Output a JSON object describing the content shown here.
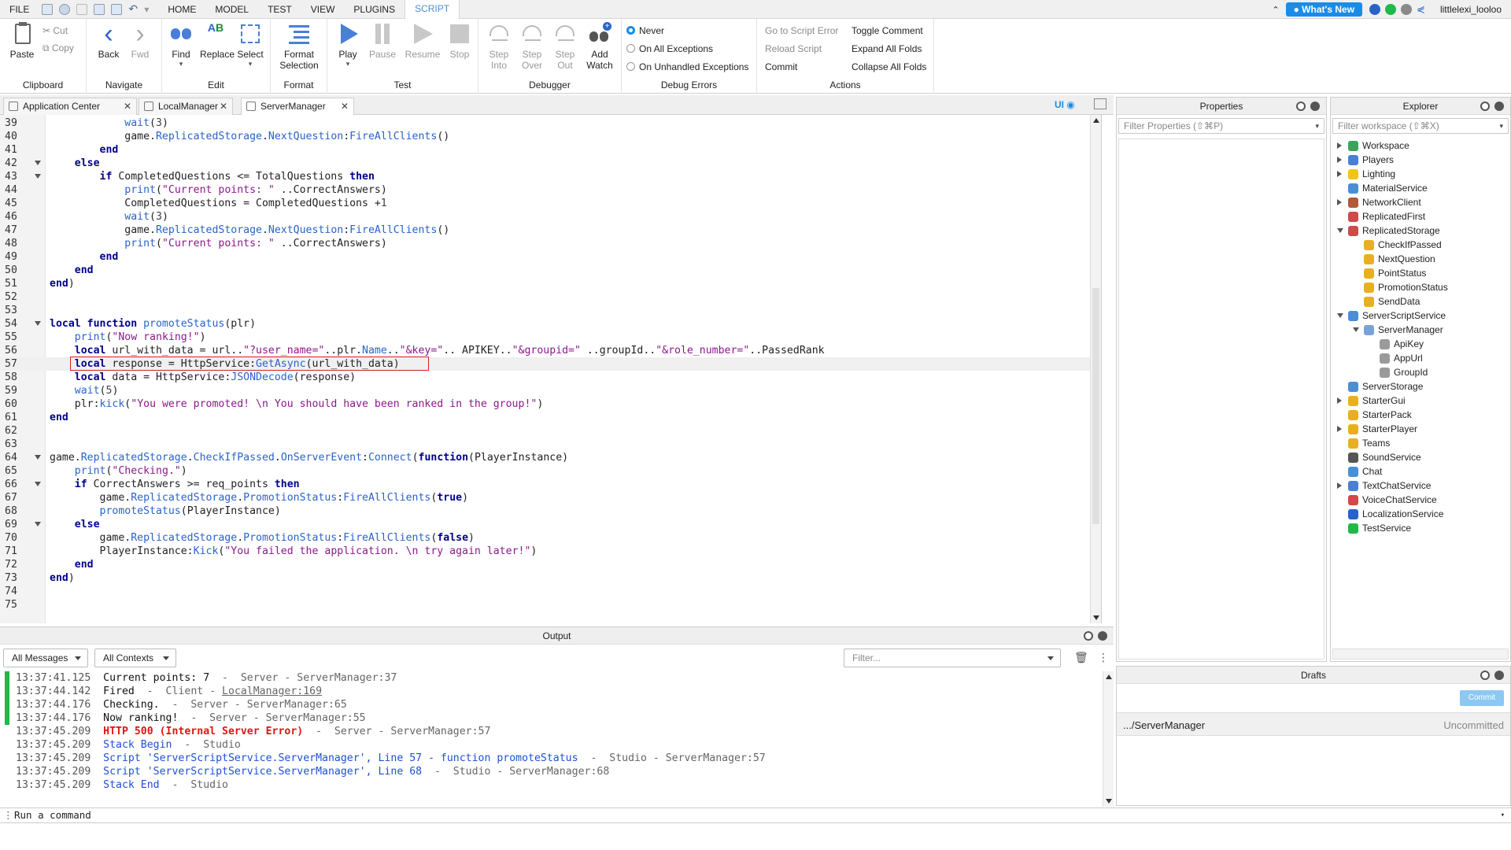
{
  "menubar": {
    "items": [
      "FILE",
      "HOME",
      "MODEL",
      "TEST",
      "VIEW",
      "PLUGINS",
      "SCRIPT"
    ],
    "active": "SCRIPT",
    "whats_new": "What's New",
    "username": "littlelexi_looloo"
  },
  "ribbon": {
    "clipboard": {
      "paste": "Paste",
      "cut": "Cut",
      "copy": "Copy",
      "label": "Clipboard"
    },
    "navigate": {
      "back": "Back",
      "fwd": "Fwd",
      "label": "Navigate"
    },
    "edit": {
      "find": "Find",
      "replace": "Replace",
      "select": "Select",
      "label": "Edit"
    },
    "format": {
      "format_selection_1": "Format",
      "format_selection_2": "Selection",
      "label": "Format"
    },
    "test": {
      "play": "Play",
      "pause": "Pause",
      "resume": "Resume",
      "stop": "Stop",
      "label": "Test"
    },
    "debugger": {
      "step_into_1": "Step",
      "step_into_2": "Into",
      "step_over_1": "Step",
      "step_over_2": "Over",
      "step_out_1": "Step",
      "step_out_2": "Out",
      "add_watch_1": "Add",
      "add_watch_2": "Watch",
      "label": "Debugger"
    },
    "debug_errors": {
      "never": "Never",
      "all": "On All Exceptions",
      "unhandled": "On Unhandled Exceptions",
      "label": "Debug Errors"
    },
    "actions": {
      "goto_error": "Go to Script Error",
      "reload": "Reload Script",
      "commit": "Commit",
      "toggle_comment": "Toggle Comment",
      "expand_folds": "Expand All Folds",
      "collapse_folds": "Collapse All Folds",
      "label": "Actions"
    }
  },
  "tabs": [
    {
      "label": "Application Center"
    },
    {
      "label": "LocalManager"
    },
    {
      "label": "ServerManager"
    }
  ],
  "editor_toolbar": {
    "ui_label": "UI"
  },
  "code_lines": [
    {
      "n": "39",
      "t": [
        [
          "",
          "            "
        ],
        [
          "fn",
          "wait"
        ],
        [
          "",
          "("
        ],
        [
          "num",
          "3"
        ],
        [
          "",
          ")"
        ]
      ]
    },
    {
      "n": "40",
      "t": [
        [
          "",
          "            game."
        ],
        [
          "fn",
          "ReplicatedStorage"
        ],
        [
          "",
          "."
        ],
        [
          "fn",
          "NextQuestion"
        ],
        [
          "",
          ":"
        ],
        [
          "fn",
          "FireAllClients"
        ],
        [
          "",
          "()"
        ]
      ]
    },
    {
      "n": "41",
      "t": [
        [
          "",
          "        "
        ],
        [
          "kw",
          "end"
        ]
      ]
    },
    {
      "n": "42",
      "t": [
        [
          "",
          "    "
        ],
        [
          "kw",
          "else"
        ]
      ]
    },
    {
      "n": "43",
      "t": [
        [
          "",
          "        "
        ],
        [
          "kw",
          "if"
        ],
        [
          "",
          " CompletedQuestions <= TotalQuestions "
        ],
        [
          "kw",
          "then"
        ]
      ]
    },
    {
      "n": "44",
      "t": [
        [
          "",
          "            "
        ],
        [
          "fn",
          "print"
        ],
        [
          "",
          "("
        ],
        [
          "str",
          "\"Current points: \""
        ],
        [
          "",
          " ..CorrectAnswers)"
        ]
      ]
    },
    {
      "n": "45",
      "t": [
        [
          "",
          "            CompletedQuestions = CompletedQuestions +"
        ],
        [
          "num",
          "1"
        ]
      ]
    },
    {
      "n": "46",
      "t": [
        [
          "",
          "            "
        ],
        [
          "fn",
          "wait"
        ],
        [
          "",
          "("
        ],
        [
          "num",
          "3"
        ],
        [
          "",
          ")"
        ]
      ]
    },
    {
      "n": "47",
      "t": [
        [
          "",
          "            game."
        ],
        [
          "fn",
          "ReplicatedStorage"
        ],
        [
          "",
          "."
        ],
        [
          "fn",
          "NextQuestion"
        ],
        [
          "",
          ":"
        ],
        [
          "fn",
          "FireAllClients"
        ],
        [
          "",
          "()"
        ]
      ]
    },
    {
      "n": "48",
      "t": [
        [
          "",
          "            "
        ],
        [
          "fn",
          "print"
        ],
        [
          "",
          "("
        ],
        [
          "str",
          "\"Current points: \""
        ],
        [
          "",
          " ..CorrectAnswers)"
        ]
      ]
    },
    {
      "n": "49",
      "t": [
        [
          "",
          "        "
        ],
        [
          "kw",
          "end"
        ]
      ]
    },
    {
      "n": "50",
      "t": [
        [
          "",
          "    "
        ],
        [
          "kw",
          "end"
        ]
      ]
    },
    {
      "n": "51",
      "t": [
        [
          "kw",
          "end"
        ],
        [
          "",
          ")"
        ]
      ]
    },
    {
      "n": "52",
      "t": []
    },
    {
      "n": "53",
      "t": []
    },
    {
      "n": "54",
      "t": [
        [
          "kw",
          "local function"
        ],
        [
          "",
          " "
        ],
        [
          "fn",
          "promoteStatus"
        ],
        [
          "",
          "(plr)"
        ]
      ]
    },
    {
      "n": "55",
      "t": [
        [
          "",
          "    "
        ],
        [
          "fn",
          "print"
        ],
        [
          "",
          "("
        ],
        [
          "str",
          "\"Now ranking!\""
        ],
        [
          "",
          ")"
        ]
      ]
    },
    {
      "n": "56",
      "t": [
        [
          "",
          "    "
        ],
        [
          "kw",
          "local"
        ],
        [
          "",
          " url_with_data = url.."
        ],
        [
          "str",
          "\"?user_name=\""
        ],
        [
          "",
          "..plr."
        ],
        [
          "fn",
          "Name"
        ],
        [
          "",
          ".."
        ],
        [
          "str",
          "\"&key=\""
        ],
        [
          "",
          ".. APIKEY.."
        ],
        [
          "str",
          "\"&groupid=\""
        ],
        [
          "",
          " ..groupId.."
        ],
        [
          "str",
          "\"&role_number=\""
        ],
        [
          "",
          "..PassedRank"
        ]
      ]
    },
    {
      "n": "57",
      "t": [
        [
          "",
          "    "
        ],
        [
          "kw",
          "local"
        ],
        [
          "",
          " response = HttpService:"
        ],
        [
          "fn",
          "GetAsync"
        ],
        [
          "",
          "(url_with_data)"
        ]
      ]
    },
    {
      "n": "58",
      "t": [
        [
          "",
          "    "
        ],
        [
          "kw",
          "local"
        ],
        [
          "",
          " data = HttpService:"
        ],
        [
          "fn",
          "JSONDecode"
        ],
        [
          "",
          "(response)"
        ]
      ]
    },
    {
      "n": "59",
      "t": [
        [
          "",
          "    "
        ],
        [
          "fn",
          "wait"
        ],
        [
          "",
          "("
        ],
        [
          "num",
          "5"
        ],
        [
          "",
          ")"
        ]
      ]
    },
    {
      "n": "60",
      "t": [
        [
          "",
          "    plr:"
        ],
        [
          "fn",
          "kick"
        ],
        [
          "",
          "("
        ],
        [
          "str",
          "\"You were promoted! \\n You should have been ranked in the group!\""
        ],
        [
          "",
          ")"
        ]
      ]
    },
    {
      "n": "61",
      "t": [
        [
          "kw",
          "end"
        ]
      ]
    },
    {
      "n": "62",
      "t": []
    },
    {
      "n": "63",
      "t": []
    },
    {
      "n": "64",
      "t": [
        [
          "",
          "game."
        ],
        [
          "fn",
          "ReplicatedStorage"
        ],
        [
          "",
          "."
        ],
        [
          "fn",
          "CheckIfPassed"
        ],
        [
          "",
          "."
        ],
        [
          "fn",
          "OnServerEvent"
        ],
        [
          "",
          ":"
        ],
        [
          "fn",
          "Connect"
        ],
        [
          "",
          "("
        ],
        [
          "kw",
          "function"
        ],
        [
          "",
          "(PlayerInstance)"
        ]
      ]
    },
    {
      "n": "65",
      "t": [
        [
          "",
          "    "
        ],
        [
          "fn",
          "print"
        ],
        [
          "",
          "("
        ],
        [
          "str",
          "\"Checking.\""
        ],
        [
          "",
          ")"
        ]
      ]
    },
    {
      "n": "66",
      "t": [
        [
          "",
          "    "
        ],
        [
          "kw",
          "if"
        ],
        [
          "",
          " CorrectAnswers >= req_points "
        ],
        [
          "kw",
          "then"
        ]
      ]
    },
    {
      "n": "67",
      "t": [
        [
          "",
          "        game."
        ],
        [
          "fn",
          "ReplicatedStorage"
        ],
        [
          "",
          "."
        ],
        [
          "fn",
          "PromotionStatus"
        ],
        [
          "",
          ":"
        ],
        [
          "fn",
          "FireAllClients"
        ],
        [
          "",
          "("
        ],
        [
          "kw",
          "true"
        ],
        [
          "",
          ")"
        ]
      ]
    },
    {
      "n": "68",
      "t": [
        [
          "",
          "        "
        ],
        [
          "fn",
          "promoteStatus"
        ],
        [
          "",
          "(PlayerInstance)"
        ]
      ]
    },
    {
      "n": "69",
      "t": [
        [
          "",
          "    "
        ],
        [
          "kw",
          "else"
        ]
      ]
    },
    {
      "n": "70",
      "t": [
        [
          "",
          "        game."
        ],
        [
          "fn",
          "ReplicatedStorage"
        ],
        [
          "",
          "."
        ],
        [
          "fn",
          "PromotionStatus"
        ],
        [
          "",
          ":"
        ],
        [
          "fn",
          "FireAllClients"
        ],
        [
          "",
          "("
        ],
        [
          "kw",
          "false"
        ],
        [
          "",
          ")"
        ]
      ]
    },
    {
      "n": "71",
      "t": [
        [
          "",
          "        PlayerInstance:"
        ],
        [
          "fn",
          "Kick"
        ],
        [
          "",
          "("
        ],
        [
          "str",
          "\"You failed the application. \\n try again later!\""
        ],
        [
          "",
          ")"
        ]
      ]
    },
    {
      "n": "72",
      "t": [
        [
          "",
          "    "
        ],
        [
          "kw",
          "end"
        ]
      ]
    },
    {
      "n": "73",
      "t": [
        [
          "kw",
          "end"
        ],
        [
          "",
          ")"
        ]
      ]
    },
    {
      "n": "74",
      "t": []
    },
    {
      "n": "75",
      "t": []
    }
  ],
  "fold_lines": [
    "42",
    "43",
    "54",
    "64",
    "66",
    "69"
  ],
  "current_line": "57",
  "output": {
    "title": "Output",
    "filter_messages": "All Messages",
    "filter_contexts": "All Contexts",
    "filter_placeholder": "Filter...",
    "lines": [
      {
        "ts": "13:37:41.125",
        "msg": "Current points: 7",
        "cls": "msg",
        "ctx": "  -  Server - ServerManager:37",
        "bar": "#1fb84a"
      },
      {
        "ts": "13:37:44.142",
        "msg": "Fired",
        "cls": "msg",
        "ctx": "  -  Client - ",
        "link": "LocalManager:169",
        "bar": "#1fb84a"
      },
      {
        "ts": "13:37:44.176",
        "msg": "Checking.",
        "cls": "msg",
        "ctx": "  -  Server - ServerManager:65",
        "bar": "#1fb84a"
      },
      {
        "ts": "13:37:44.176",
        "msg": "Now ranking!",
        "cls": "msg",
        "ctx": "  -  Server - ServerManager:55",
        "bar": "#1fb84a"
      },
      {
        "ts": "13:37:45.209",
        "msg": "HTTP 500 (Internal Server Error)",
        "cls": "err",
        "ctx": "  -  Server - ServerManager:57",
        "bar": ""
      },
      {
        "ts": "13:37:45.209",
        "msg": "Stack Begin",
        "cls": "info",
        "ctx": "  -  Studio",
        "bar": ""
      },
      {
        "ts": "13:37:45.209",
        "msg": "Script 'ServerScriptService.ServerManager', Line 57 - function promoteStatus",
        "cls": "info",
        "ctx": "  -  Studio - ServerManager:57",
        "bar": ""
      },
      {
        "ts": "13:37:45.209",
        "msg": "Script 'ServerScriptService.ServerManager', Line 68",
        "cls": "info",
        "ctx": "  -  Studio - ServerManager:68",
        "bar": ""
      },
      {
        "ts": "13:37:45.209",
        "msg": "Stack End",
        "cls": "info",
        "ctx": "  -  Studio",
        "bar": ""
      }
    ]
  },
  "command_bar": {
    "placeholder": "Run a command"
  },
  "properties": {
    "title": "Properties",
    "filter": "Filter Properties (⇧⌘P)"
  },
  "explorer": {
    "title": "Explorer",
    "filter": "Filter workspace (⇧⌘X)",
    "items": [
      {
        "label": "Workspace",
        "depth": 0,
        "exp": "r",
        "color": "#3aa55a"
      },
      {
        "label": "Players",
        "depth": 0,
        "exp": "r",
        "color": "#4a7fd6"
      },
      {
        "label": "Lighting",
        "depth": 0,
        "exp": "r",
        "color": "#f2c31a"
      },
      {
        "label": "MaterialService",
        "depth": 0,
        "exp": "",
        "color": "#4a8fd6"
      },
      {
        "label": "NetworkClient",
        "depth": 0,
        "exp": "r",
        "color": "#b05a3a"
      },
      {
        "label": "ReplicatedFirst",
        "depth": 0,
        "exp": "",
        "color": "#d04a4a"
      },
      {
        "label": "ReplicatedStorage",
        "depth": 0,
        "exp": "d",
        "color": "#d04a4a"
      },
      {
        "label": "CheckIfPassed",
        "depth": 1,
        "exp": "",
        "color": "#e8b020"
      },
      {
        "label": "NextQuestion",
        "depth": 1,
        "exp": "",
        "color": "#e8b020"
      },
      {
        "label": "PointStatus",
        "depth": 1,
        "exp": "",
        "color": "#e8b020"
      },
      {
        "label": "PromotionStatus",
        "depth": 1,
        "exp": "",
        "color": "#e8b020"
      },
      {
        "label": "SendData",
        "depth": 1,
        "exp": "",
        "color": "#e8b020"
      },
      {
        "label": "ServerScriptService",
        "depth": 0,
        "exp": "d",
        "color": "#4a8fd6"
      },
      {
        "label": "ServerManager",
        "depth": 1,
        "exp": "d",
        "color": "#7aa2d8"
      },
      {
        "label": "ApiKey",
        "depth": 2,
        "exp": "",
        "color": "#9a9a9a"
      },
      {
        "label": "AppUrl",
        "depth": 2,
        "exp": "",
        "color": "#9a9a9a"
      },
      {
        "label": "GroupId",
        "depth": 2,
        "exp": "",
        "color": "#9a9a9a"
      },
      {
        "label": "ServerStorage",
        "depth": 0,
        "exp": "",
        "color": "#4a8fd6"
      },
      {
        "label": "StarterGui",
        "depth": 0,
        "exp": "r",
        "color": "#e8b020"
      },
      {
        "label": "StarterPack",
        "depth": 0,
        "exp": "",
        "color": "#e8b020"
      },
      {
        "label": "StarterPlayer",
        "depth": 0,
        "exp": "r",
        "color": "#e8b020"
      },
      {
        "label": "Teams",
        "depth": 0,
        "exp": "",
        "color": "#e8b020"
      },
      {
        "label": "SoundService",
        "depth": 0,
        "exp": "",
        "color": "#555555"
      },
      {
        "label": "Chat",
        "depth": 0,
        "exp": "",
        "color": "#4a8fd6"
      },
      {
        "label": "TextChatService",
        "depth": 0,
        "exp": "r",
        "color": "#4a7fd6"
      },
      {
        "label": "VoiceChatService",
        "depth": 0,
        "exp": "",
        "color": "#d04a4a"
      },
      {
        "label": "LocalizationService",
        "depth": 0,
        "exp": "",
        "color": "#2a63c8"
      },
      {
        "label": "TestService",
        "depth": 0,
        "exp": "",
        "color": "#1fb84a"
      }
    ]
  },
  "drafts": {
    "title": "Drafts",
    "commit": "Commit",
    "item": ".../ServerManager",
    "status": "Uncommitted"
  }
}
